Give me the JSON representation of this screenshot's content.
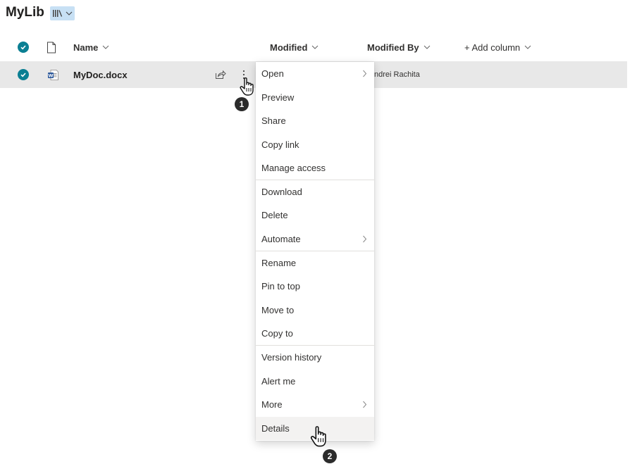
{
  "library": {
    "title": "MyLib"
  },
  "header": {
    "name": "Name",
    "modified": "Modified",
    "modified_by": "Modified By",
    "add_column": "+ Add column"
  },
  "file": {
    "name": "MyDoc.docx",
    "modified_by": "ndrei Rachita",
    "icon": "word-file-icon"
  },
  "menu": {
    "items": [
      {
        "label": "Open",
        "submenu": true
      },
      {
        "label": "Preview"
      },
      {
        "label": "Share"
      },
      {
        "label": "Copy link"
      },
      {
        "label": "Manage access"
      },
      {
        "label": "Download"
      },
      {
        "label": "Delete"
      },
      {
        "label": "Automate",
        "submenu": true
      },
      {
        "label": "Rename"
      },
      {
        "label": "Pin to top"
      },
      {
        "label": "Move to"
      },
      {
        "label": "Copy to"
      },
      {
        "label": "Version history"
      },
      {
        "label": "Alert me"
      },
      {
        "label": "More",
        "submenu": true
      },
      {
        "label": "Details",
        "active": true
      }
    ]
  },
  "callouts": {
    "step1": "1",
    "step2": "2"
  },
  "colors": {
    "accent": "#0b7f93",
    "selected_row": "#e8e8e8",
    "view_switch": "#c7e0f4"
  }
}
